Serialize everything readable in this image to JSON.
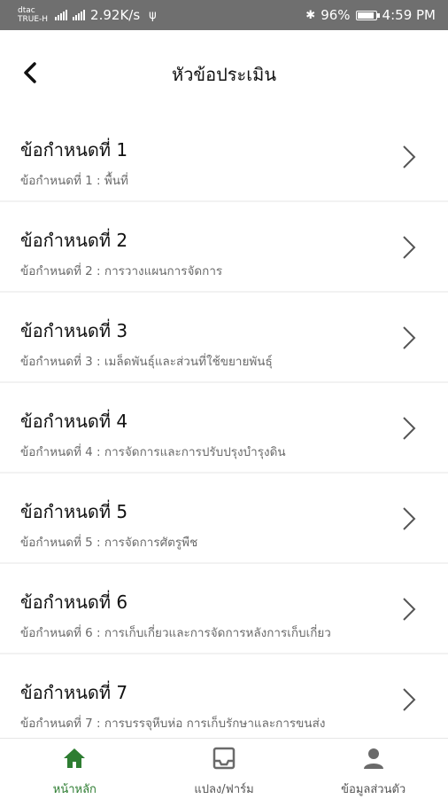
{
  "status_bar": {
    "carrier_top": "dtac",
    "carrier_bottom": "TRUE-H",
    "network_speed": "2.92K/s",
    "battery": "96%",
    "time": "4:59 PM"
  },
  "header": {
    "title": "หัวข้อประเมิน"
  },
  "items": [
    {
      "title": "ข้อกำหนดที่ 1",
      "subtitle": "ข้อกำหนดที่ 1 : พื้นที่"
    },
    {
      "title": "ข้อกำหนดที่ 2",
      "subtitle": "ข้อกำหนดที่ 2 : การวางแผนการจัดการ"
    },
    {
      "title": "ข้อกำหนดที่ 3",
      "subtitle": "ข้อกำหนดที่ 3 : เมล็ดพันธุ์และส่วนที่ใช้ขยายพันธุ์"
    },
    {
      "title": "ข้อกำหนดที่ 4",
      "subtitle": "ข้อกำหนดที่ 4 : การจัดการและการปรับปรุงบำรุงดิน"
    },
    {
      "title": "ข้อกำหนดที่ 5",
      "subtitle": "ข้อกำหนดที่ 5 : การจัดการศัตรูพืช"
    },
    {
      "title": "ข้อกำหนดที่ 6",
      "subtitle": "ข้อกำหนดที่ 6 : การเก็บเกี่ยวและการจัดการหลังการเก็บเกี่ยว"
    },
    {
      "title": "ข้อกำหนดที่ 7",
      "subtitle": "ข้อกำหนดที่ 7 : การบรรจุหีบห่อ การเก็บรักษาและการขนส่ง"
    }
  ],
  "bottom_nav": {
    "home_label": "หน้าหลัก",
    "plot_label": "แปลง/ฟาร์ม",
    "profile_label": "ข้อมูลส่วนตัว"
  },
  "colors": {
    "accent": "#2e7d32",
    "status_bar": "#6f6f6f"
  }
}
